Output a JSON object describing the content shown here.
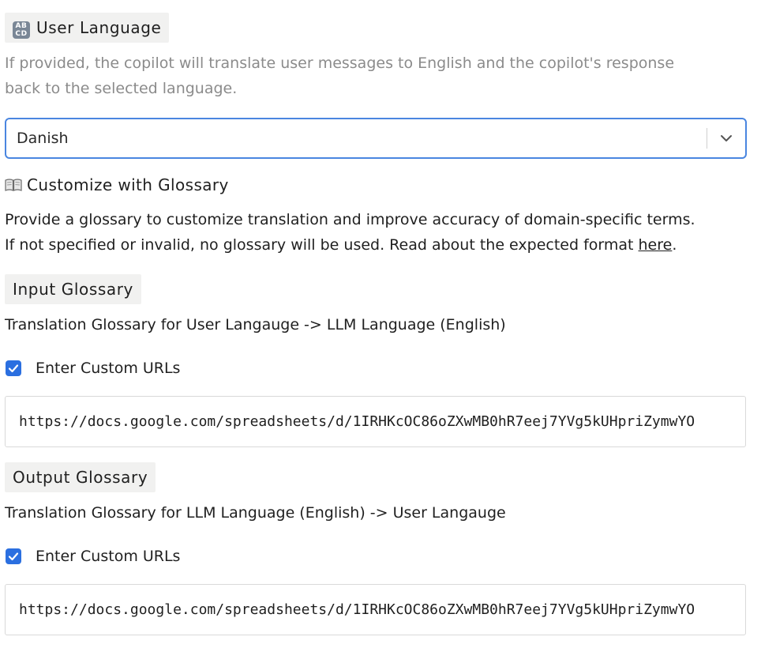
{
  "user_language": {
    "badge": "🔤",
    "title": "User Language",
    "description_line1": "If provided, the copilot will translate user messages to English and the copilot's response",
    "description_line2": "back to the selected language.",
    "selected_value": "Danish",
    "accent_color": "#4a86e0"
  },
  "glossary": {
    "title": "Customize with Glossary",
    "icon": "book-icon",
    "description_line1": "Provide a glossary to customize translation and improve accuracy of domain-specific terms.",
    "description_line2_prefix": "If not specified or invalid, no glossary will be used. Read about the expected format ",
    "link_text": "here",
    "description_line2_suffix": "."
  },
  "input_glossary": {
    "title": "Input Glossary",
    "subtitle": "Translation Glossary for User Langauge -> LLM Language (English)",
    "checkbox_label": "Enter Custom URLs",
    "checked": true,
    "url_value": "https://docs.google.com/spreadsheets/d/1IRHKcOC86oZXwMB0hR7eej7YVg5kUHpriZymwYO"
  },
  "output_glossary": {
    "title": "Output Glossary",
    "subtitle": "Translation Glossary for LLM Language (English) -> User Langauge",
    "checkbox_label": "Enter Custom URLs",
    "checked": true,
    "url_value": "https://docs.google.com/spreadsheets/d/1IRHKcOC86oZXwMB0hR7eej7YVg5kUHpriZymwYO"
  },
  "checkbox_color": "#2b6fe0"
}
